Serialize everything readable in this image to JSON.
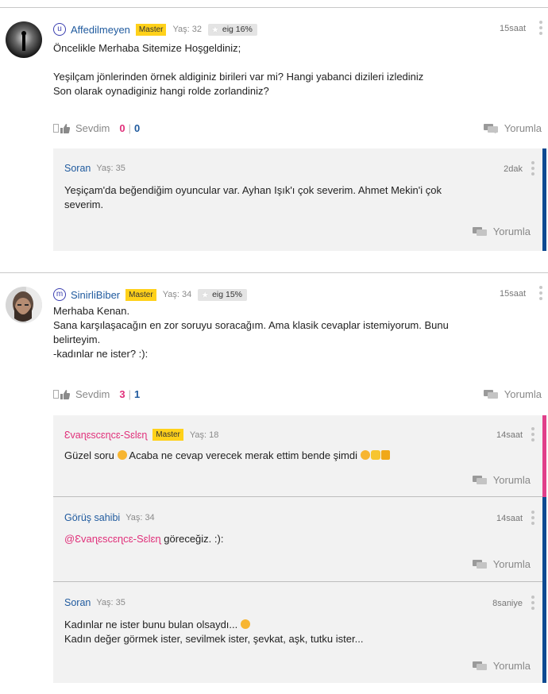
{
  "posts": [
    {
      "username": "Affedilmeyen",
      "user_icon_letter": "u",
      "badge": "Master",
      "age": "Yaş: 32",
      "eig": "eig 16%",
      "time": "15saat",
      "lines": [
        "Öncelikle Merhaba Sitemize Hoşgeldiniz;",
        "Yeşilçam jönlerinden örnek aldiginiz birileri var mi? Hangi yabanci dizileri izlediniz",
        "Son olarak oynadiginiz hangi rolde zorlandiniz?"
      ],
      "like_label": "Sevdim",
      "likes": "0",
      "sep": "|",
      "comments": "0",
      "reply_label": "Yorumla",
      "replies": [
        {
          "username": "Soran",
          "age": "Yaş: 35",
          "time": "2dak",
          "lines": [
            "Yeşiçam'da beğendiğim oyuncular var. Ayhan Işık'ı çok severim. Ahmet Mekin'i çok",
            "severim."
          ],
          "reply_label": "Yorumla"
        }
      ]
    },
    {
      "username": "SinirliBiber",
      "user_icon_letter": "m",
      "badge": "Master",
      "age": "Yaş: 34",
      "eig": "eig 15%",
      "time": "15saat",
      "lines": [
        "Merhaba Kenan.",
        "Sana karşılaşacağın en zor soruyu soracağım. Ama klasik cevaplar istemiyorum. Bunu",
        "belirteyim.",
        "-kadınlar ne ister? :):"
      ],
      "like_label": "Sevdim",
      "likes": "3",
      "sep": "|",
      "comments": "1",
      "reply_label": "Yorumla",
      "replies": [
        {
          "username": "Ɛvaɳɛscɛɳcɛ-Sɛlɛɳ",
          "badge": "Master",
          "age": "Yaş: 18",
          "time": "14saat",
          "line_1": "Güzel soru",
          "line_2": "Acaba ne cevap verecek merak ettim bende şimdi",
          "reply_label": "Yorumla"
        },
        {
          "username": "Görüş sahibi",
          "age": "Yaş: 34",
          "time": "14saat",
          "mention": "@Ɛvaɳɛscɛɳcɛ-Sɛlɛɳ",
          "text": "göreceğiz. :):",
          "reply_label": "Yorumla"
        },
        {
          "username": "Soran",
          "age": "Yaş: 35",
          "time": "8saniye",
          "line_1": "Kadınlar ne ister bunu bulan olsaydı...",
          "line_2": "Kadın değer görmek ister, sevilmek ister, şevkat, aşk, tutku ister...",
          "reply_label": "Yorumla"
        }
      ]
    }
  ],
  "colors": {
    "username": "#1f5a9e",
    "badge": "#ffd11a",
    "reply_border_blue": "#0f4a91",
    "reply_border_pink": "#e13f8a",
    "likes_color": "#e0307a",
    "comments_color": "#1f5a9e"
  }
}
